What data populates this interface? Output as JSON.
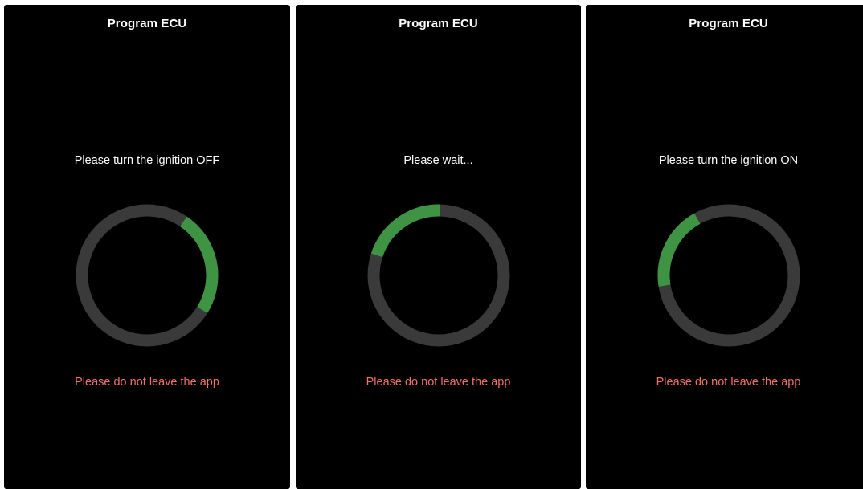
{
  "colors": {
    "background": "#000000",
    "track": "#3a3a3a",
    "progress": "#3f9443",
    "warning": "#f07366",
    "text": "#ffffff"
  },
  "screens": [
    {
      "title": "Program ECU",
      "instruction": "Please turn the ignition OFF",
      "warning": "Please do not leave the app",
      "spinner": {
        "arc_start_deg": 34,
        "arc_sweep_deg": 88
      }
    },
    {
      "title": "Program ECU",
      "instruction": "Please wait...",
      "warning": "Please do not leave the app",
      "spinner": {
        "arc_start_deg": 288,
        "arc_sweep_deg": 73
      }
    },
    {
      "title": "Program ECU",
      "instruction": "Please turn the ignition ON",
      "warning": "Please do not leave the app",
      "spinner": {
        "arc_start_deg": 261,
        "arc_sweep_deg": 70
      }
    }
  ]
}
